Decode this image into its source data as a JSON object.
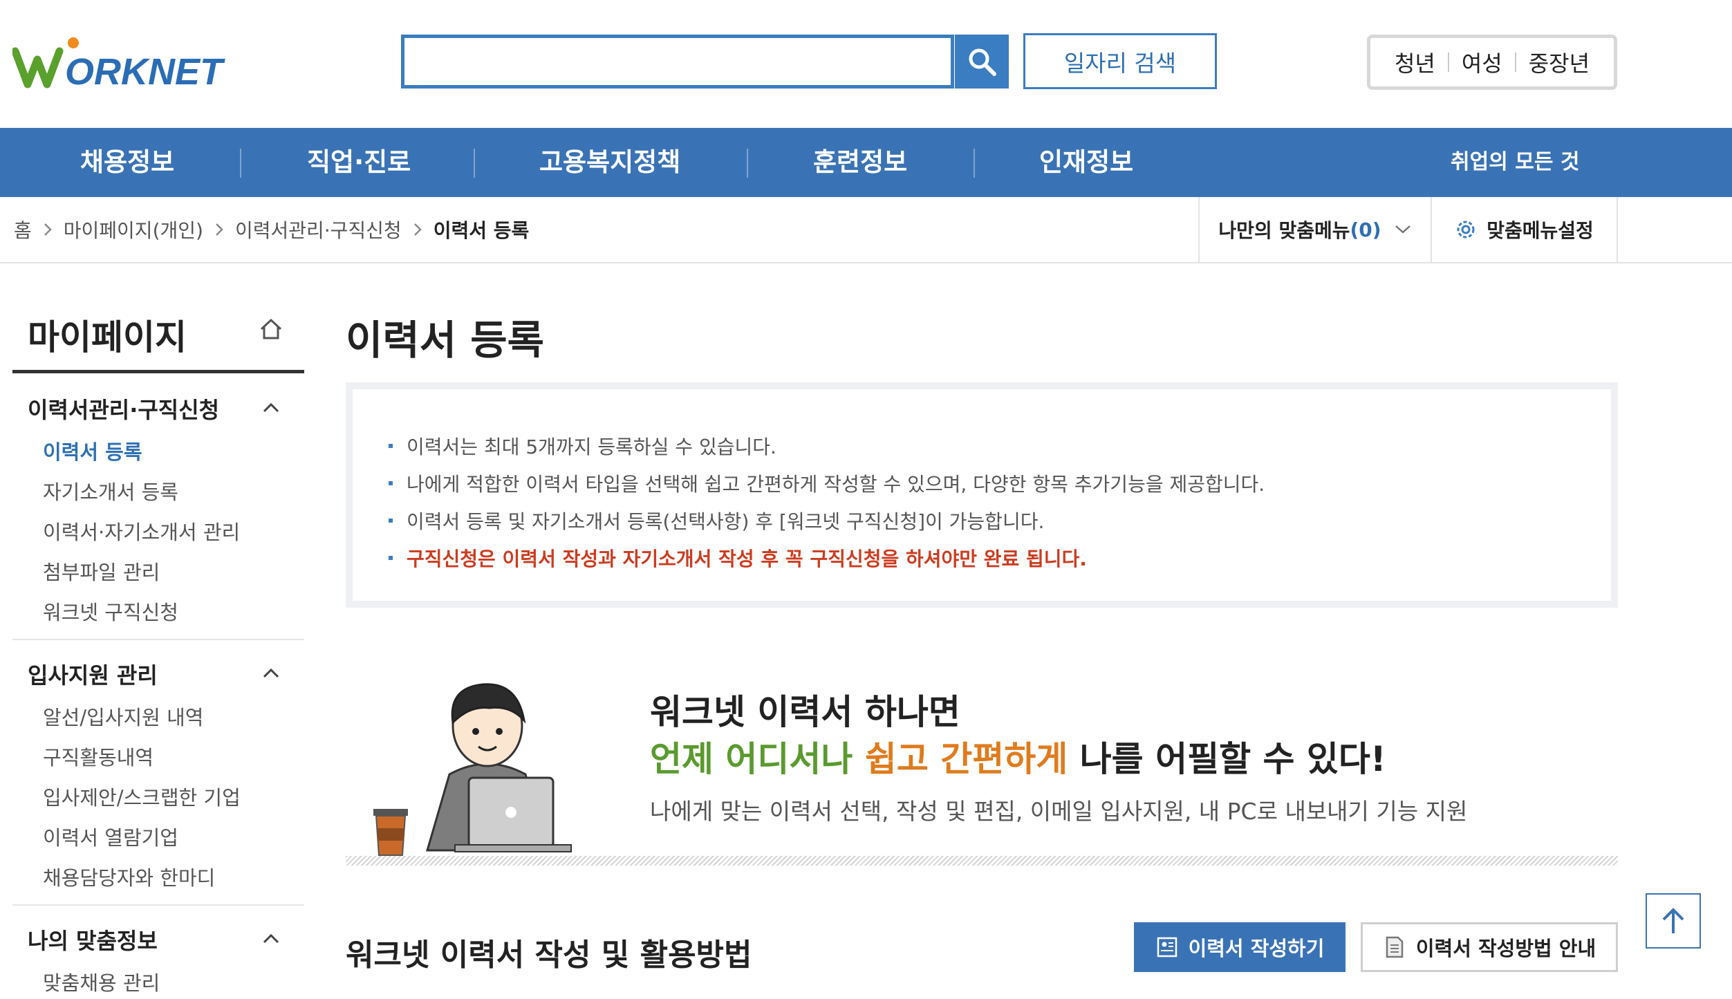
{
  "header": {
    "logo_text": "WORKNET",
    "search": {
      "placeholder": "",
      "value": ""
    },
    "job_search_label": "일자리 검색",
    "group_tabs": [
      "청년",
      "여성",
      "중장년"
    ]
  },
  "gnb": {
    "items": [
      "채용정보",
      "직업·진로",
      "고용복지정책",
      "훈련정보",
      "인재정보"
    ],
    "all_label": "취업의 모든 것"
  },
  "breadcrumb": {
    "items": [
      "홈",
      "마이페이지(개인)",
      "이력서관리·구직신청",
      "이력서 등록"
    ],
    "my_menu_label": "나만의 맞춤메뉴",
    "my_menu_count": "(0)",
    "my_menu_settings_label": "맞춤메뉴설정"
  },
  "sidebar": {
    "title": "마이페이지",
    "sections": [
      {
        "title": "이력서관리·구직신청",
        "items": [
          "이력서 등록",
          "자기소개서 등록",
          "이력서·자기소개서 관리",
          "첨부파일 관리",
          "워크넷 구직신청"
        ],
        "active": 0
      },
      {
        "title": "입사지원 관리",
        "items": [
          "알선/입사지원 내역",
          "구직활동내역",
          "입사제안/스크랩한 기업",
          "이력서 열람기업",
          "채용담당자와 한마디"
        ]
      },
      {
        "title": "나의 맞춤정보",
        "items": [
          "맞춤채용 관리"
        ]
      }
    ]
  },
  "main": {
    "title": "이력서 등록",
    "notice": [
      "이력서는 최대 5개까지 등록하실 수 있습니다.",
      "나에게 적합한 이력서 타입을 선택해 쉽고 간편하게 작성할 수 있으며, 다양한 항목 추가기능을 제공합니다.",
      "이력서 등록 및 자기소개서 등록(선택사항) 후 [워크넷 구직신청]이 가능합니다.",
      "구직신청은 이력서 작성과 자기소개서 작성 후 꼭 구직신청을 하셔야만 완료 됩니다."
    ],
    "hero": {
      "line1": "워크넷 이력서 하나면",
      "line2_green": "언제 어디서나",
      "line2_space": " ",
      "line2_orange": "쉽고 간편하게",
      "line2_rest": " 나를 어필할 수 있다!",
      "sub": "나에게 맞는 이력서 선택, 작성 및 편집, 이메일 입사지원, 내 PC로 내보내기 기능 지원"
    },
    "guide_title": "워크넷 이력서 작성 및 활용방법",
    "write_button": "이력서 작성하기",
    "guide_button": "이력서 작성방법 안내"
  },
  "colors": {
    "primary": "#3a73b5",
    "accent_blue": "#2f6fb3",
    "notice_red": "#cc3b1f",
    "hero_green": "#5a9a2e",
    "hero_orange": "#e07b1d"
  }
}
